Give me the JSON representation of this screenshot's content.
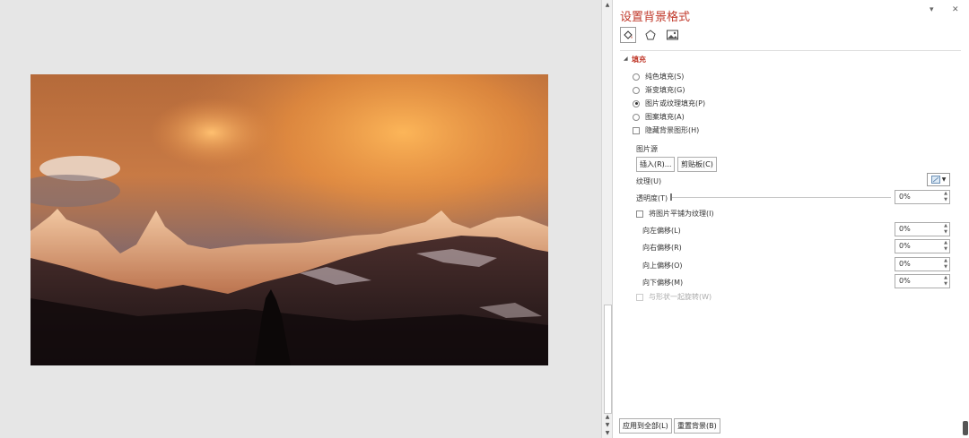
{
  "panel": {
    "title": "设置背景格式",
    "section_fill": "填充",
    "options": {
      "solid": "纯色填充(S)",
      "gradient": "渐变填充(G)",
      "picture": "图片或纹理填充(P)",
      "pattern": "图案填充(A)"
    },
    "selected_option": "picture",
    "hide_bg": "隐藏背景图形(H)",
    "picture_source": "图片源",
    "insert_btn": "插入(R)...",
    "clipboard_btn": "剪贴板(C)",
    "texture_label": "纹理(U)",
    "transparency_label": "透明度(T)",
    "transparency_value": "0%",
    "tile_label": "将图片平铺为纹理(I)",
    "offset_left_label": "向左偏移(L)",
    "offset_left_value": "0%",
    "offset_right_label": "向右偏移(R)",
    "offset_right_value": "0%",
    "offset_top_label": "向上偏移(O)",
    "offset_top_value": "0%",
    "offset_bottom_label": "向下偏移(M)",
    "offset_bottom_value": "0%",
    "rotate_label": "与形状一起旋转(W)",
    "apply_all_btn": "应用到全部(L)",
    "reset_btn": "重置背景(B)"
  },
  "icons": {
    "dropdown": "▾",
    "close": "✕",
    "collapse": "◢"
  },
  "colors": {
    "accent": "#c0392b"
  }
}
